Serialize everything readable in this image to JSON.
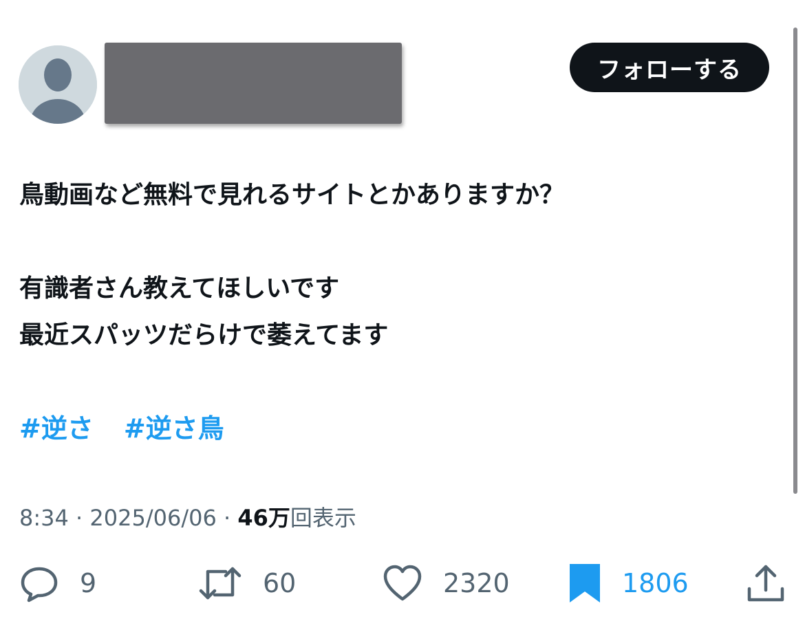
{
  "header": {
    "follow_label": "フォローする"
  },
  "tweet": {
    "lines": [
      "鳥動画など無料で見れるサイトとかありますか？",
      "",
      "有識者さん教えてほしいです",
      "最近スパッツだらけで萎えてます"
    ],
    "hashtags": [
      "#逆さ",
      "#逆さ鳥"
    ]
  },
  "meta": {
    "time": "8:34",
    "date": "2025/06/06",
    "views_count": "46万",
    "views_label": "回表示",
    "separator": " · "
  },
  "actions": {
    "reply_count": "9",
    "retweet_count": "60",
    "like_count": "2320",
    "bookmark_count": "1806"
  },
  "colors": {
    "accent": "#1d9bf0",
    "muted": "#536471",
    "text": "#0f1419",
    "avatar_bg": "#cfd9de"
  },
  "icons": {
    "avatar": "default-profile-icon",
    "reply": "reply-icon",
    "retweet": "retweet-icon",
    "like": "heart-icon",
    "bookmark": "bookmark-filled-icon",
    "share": "share-icon"
  }
}
